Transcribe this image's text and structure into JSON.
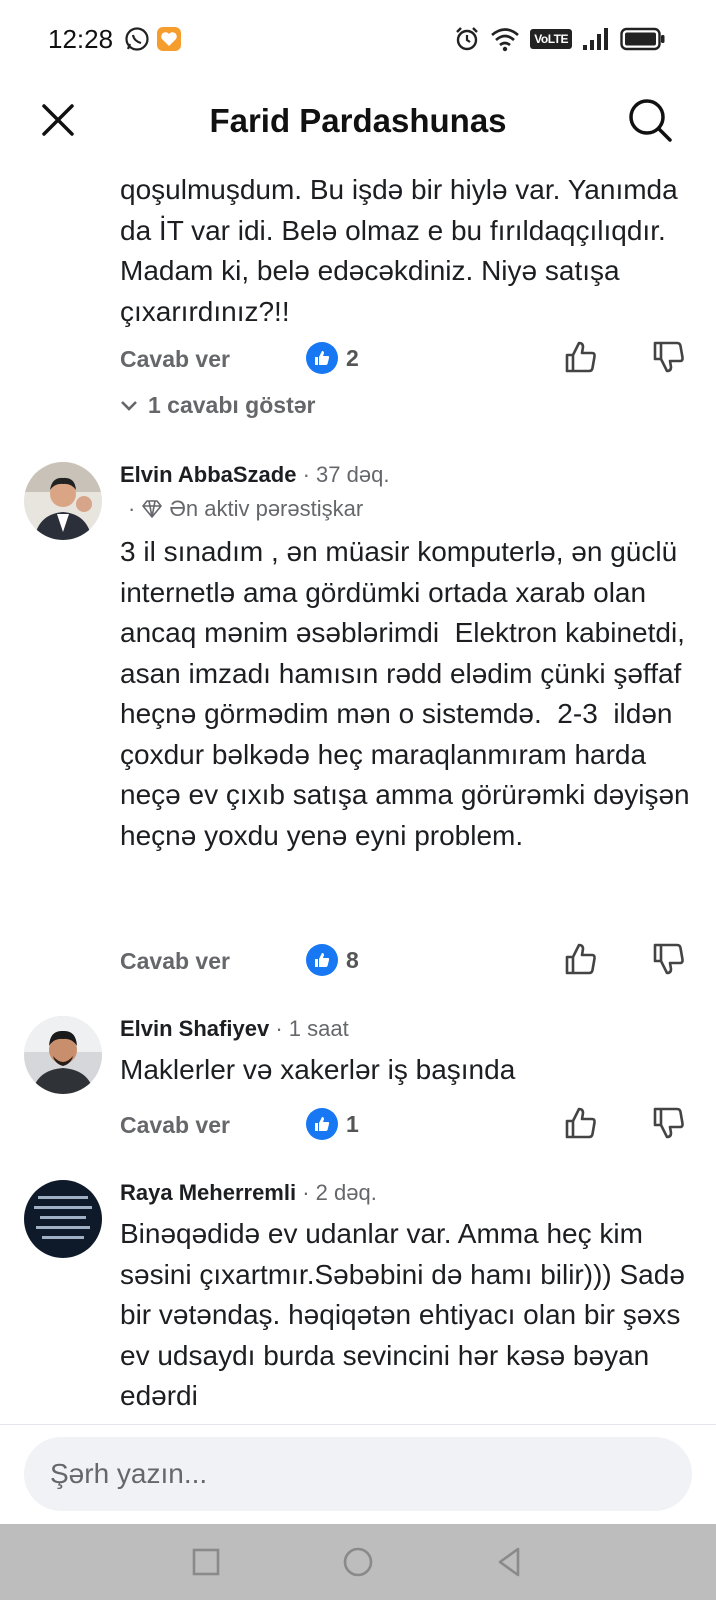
{
  "status_bar": {
    "time": "12:28",
    "network_label": "VoLTE"
  },
  "header": {
    "title": "Farid Pardashunas"
  },
  "comments": [
    {
      "partial": true,
      "text": "qoşulmuşdum. Bu işdə bir hiylə var. Yanımda da İT var idi. Belə olmaz e bu fırıldaqçılıqdır. Madam ki, belə edəcəkdiniz. Niyə satışa çıxarırdınız?!!",
      "reply_label": "Cavab ver",
      "like_count": "2",
      "show_replies": "1 cavabı göstər"
    },
    {
      "name": "Elvin AbbaSzade",
      "time": "37 dəq.",
      "badge": "Ən aktiv pərəstişkar",
      "text": "3 il sınadım , ən müasir komputerlə, ən güclü internetlə ama gördümki ortada xarab olan ancaq mənim əsəblərimdi  Elektron kabinetdi, asan imzadı hamısın rədd elədim çünki şəffaf heçnə görmədim mən o sistemdə.  2-3  ildən çoxdur bəlkədə heç maraqlanmıram harda neçə ev çıxıb satışa amma görürəmki dəyişən heçnə yoxdu yenə eyni problem.",
      "reply_label": "Cavab ver",
      "like_count": "8"
    },
    {
      "name": "Elvin Shafiyev",
      "time": "1 saat",
      "text": "Maklerler və xakerlər iş başında",
      "reply_label": "Cavab ver",
      "like_count": "1"
    },
    {
      "name": "Raya Meherremli",
      "time": "2 dəq.",
      "text": "Binəqədidə ev udanlar var. Amma heç kim səsini çıxartmır.Səbəbini də hamı bilir))) Sadə bir vətəndaş. həqiqətən ehtiyacı olan bir şəxs ev udsaydı burda sevincini hər kəsə bəyan edərdi"
    }
  ],
  "composer": {
    "placeholder": "Şərh yazın..."
  },
  "colors": {
    "accent": "#1877f2",
    "secondary_text": "#65676b",
    "nav_bar": "#bdbdbd"
  }
}
